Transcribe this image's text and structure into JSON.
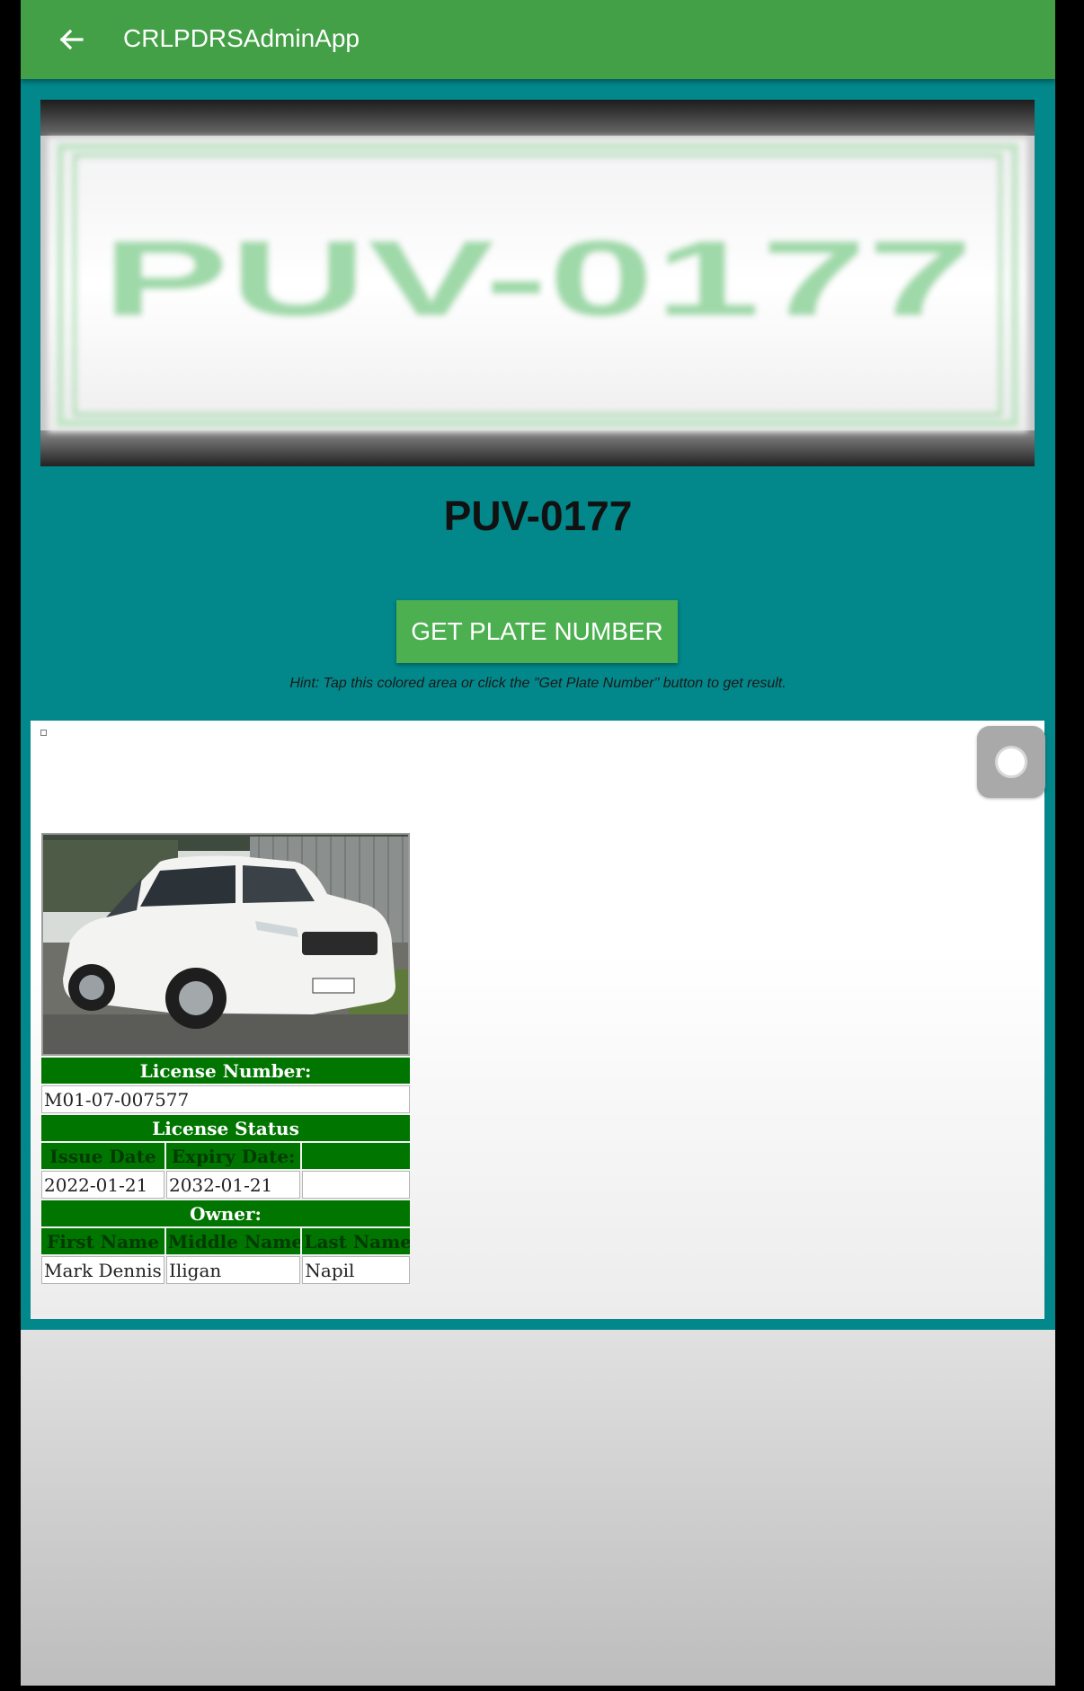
{
  "appbar": {
    "title": "CRLPDRSAdminApp",
    "color": "#43a047"
  },
  "scanner": {
    "camera_plate_text": "PUV-0177",
    "recognized_plate": "PUV-0177",
    "button_label": "GET PLATE NUMBER",
    "hint": "Hint: Tap this colored area or click the \"Get Plate Number\" button to get result.",
    "panel_color": "#02878a"
  },
  "record": {
    "license_number_label": "License Number:",
    "license_number": "M01-07-007577",
    "license_status_label": "License Status",
    "issue_date_label": "Issue Date",
    "expiry_date_label": "Expiry Date:",
    "issue_date": "2022-01-21",
    "expiry_date": "2032-01-21",
    "owner_label": "Owner:",
    "first_name_label": "First Name",
    "middle_name_label": "Middle Name",
    "last_name_label": "Last Name",
    "first_name": "Mark Dennis",
    "middle_name": "Iligan",
    "last_name": "Napil",
    "header_color": "#007500"
  },
  "icons": {
    "back": "arrow-left-icon",
    "float": "assistive-touch-icon"
  }
}
